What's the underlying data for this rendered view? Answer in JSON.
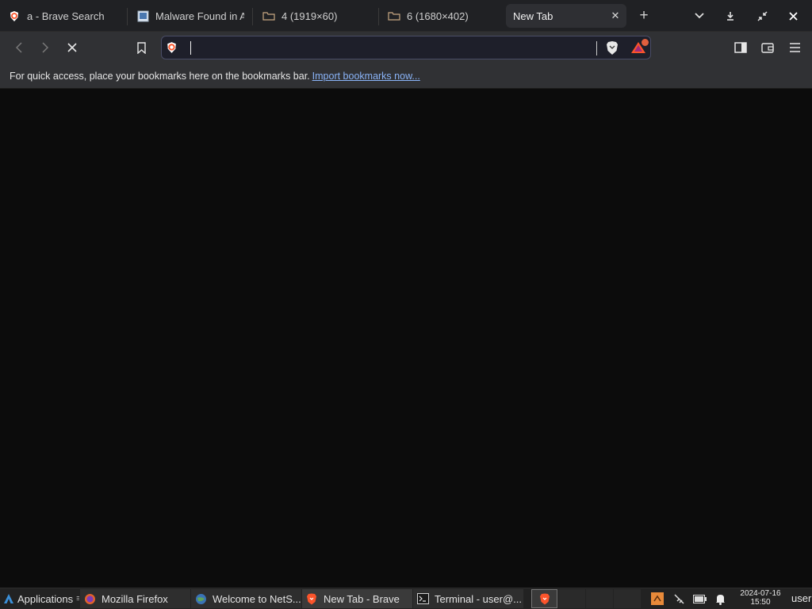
{
  "tabs": [
    {
      "label": "a - Brave Search",
      "icon": "brave-search-icon",
      "active": false
    },
    {
      "label": "Malware Found in A",
      "icon": "image-page-icon",
      "active": false
    },
    {
      "label": "4 (1919×60)",
      "icon": "image-file-icon",
      "active": false
    },
    {
      "label": "6 (1680×402)",
      "icon": "image-file-icon",
      "active": false
    },
    {
      "label": "New Tab",
      "icon": "",
      "active": true
    }
  ],
  "tab_close_glyph": "✕",
  "new_tab_glyph": "+",
  "window_controls": [
    "chevron-down-icon",
    "download-icon",
    "minimize-icon",
    "close-icon"
  ],
  "omnibox": {
    "value": "",
    "placeholder": ""
  },
  "rewards_badge_count": "",
  "bookmarks_bar": {
    "message": "For quick access, place your bookmarks here on the bookmarks bar.",
    "link": "Import bookmarks now..."
  },
  "taskbar": {
    "menu_label": "Applications",
    "tasks": [
      {
        "label": "Mozilla Firefox",
        "icon": "firefox-icon"
      },
      {
        "label": "Welcome to NetS...",
        "icon": "globe-icon"
      },
      {
        "label": "New Tab - Brave",
        "icon": "brave-icon"
      },
      {
        "label": "Terminal - user@...",
        "icon": "terminal-icon"
      }
    ],
    "clock_date": "2024-07-16",
    "clock_time": "15:50",
    "user": "user"
  },
  "colors": {
    "accent": "#fb542b",
    "link": "#8ab4f8",
    "background": "#0c0c0c",
    "toolbar": "#303134"
  }
}
